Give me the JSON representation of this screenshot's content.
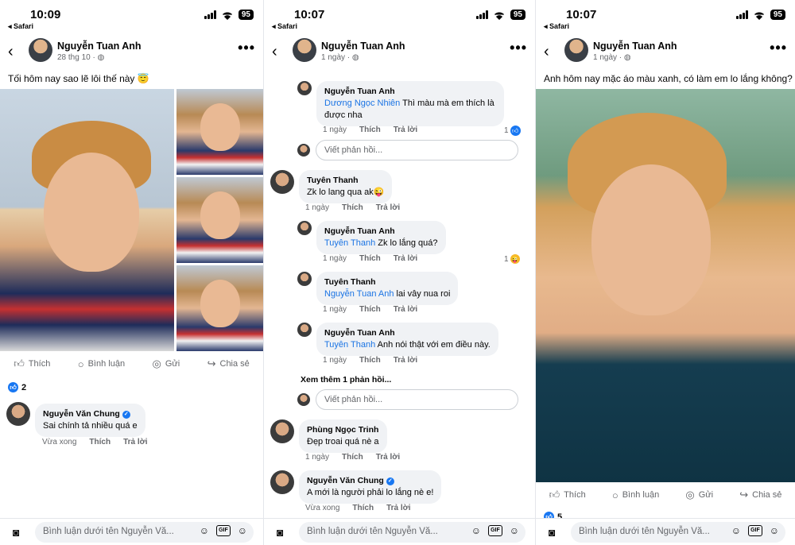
{
  "panels": [
    {
      "status": {
        "time": "10:09",
        "back_app": "Safari",
        "battery": "95"
      },
      "author": {
        "name": "Nguyễn Tuan Anh",
        "time": "28 thg 10"
      },
      "caption": "Tối hôm nay sao lẽ lôi thế này 😇",
      "actions": {
        "like": "Thích",
        "comment": "Bình luận",
        "send": "Gửi",
        "share": "Chia sẻ"
      },
      "reaction_count": "2",
      "comments": [
        {
          "author": "Nguyễn Văn Chung",
          "text": "Sai chính tả nhiều quá e",
          "time": "Vừa xong",
          "like": "Thích",
          "reply": "Trả lời"
        }
      ],
      "composer": {
        "placeholder": "Bình luận dưới tên Nguyễn Vă..."
      }
    },
    {
      "status": {
        "time": "10:07",
        "back_app": "Safari",
        "battery": "95"
      },
      "author": {
        "name": "Nguyễn Tuan Anh",
        "time": "1 ngày"
      },
      "comments": [
        {
          "author": "Nguyễn Tuan Anh",
          "mention": "Dương Ngọc Nhiên",
          "text": "Thì màu mà em thích là được nha",
          "time": "1 ngày",
          "like": "Thích",
          "reply": "Trả lời",
          "count": "1"
        },
        {
          "author": "Tuyên Thanh",
          "text": "Zk lo lang qua ak😜",
          "time": "1 ngày",
          "like": "Thích",
          "reply": "Trả lời"
        },
        {
          "author": "Nguyễn Tuan Anh",
          "mention": "Tuyên Thanh",
          "text": "Zk lo lắng quá?",
          "time": "1 ngày",
          "like": "Thích",
          "reply": "Trả lời",
          "count": "1"
        },
        {
          "author": "Tuyên Thanh",
          "mention": "Nguyễn Tuan Anh",
          "text": "lai vây nua roi",
          "time": "1 ngày",
          "like": "Thích",
          "reply": "Trả lời"
        },
        {
          "author": "Nguyễn Tuan Anh",
          "mention": "Tuyên Thanh",
          "text": "Anh nói thật với em điều này.",
          "time": "1 ngày",
          "like": "Thích",
          "reply": "Trả lời"
        },
        {
          "author": "Phùng Ngọc Trinh",
          "text": "Đẹp troai quá nè a",
          "time": "1 ngày",
          "like": "Thích",
          "reply": "Trả lời"
        },
        {
          "author": "Nguyễn Văn Chung",
          "text": "A mới là người phải lo lắng nè e!",
          "time": "Vừa xong",
          "like": "Thích",
          "reply": "Trả lời"
        }
      ],
      "reply_placeholder": "Viết phản hồi...",
      "more_replies": "Xem thêm 1 phản hồi...",
      "composer": {
        "placeholder": "Bình luận dưới tên Nguyễn Vă..."
      }
    },
    {
      "status": {
        "time": "10:07",
        "back_app": "Safari",
        "battery": "95"
      },
      "author": {
        "name": "Nguyễn Tuan Anh",
        "time": "1 ngày"
      },
      "caption": "Anh hôm nay mặc áo màu xanh, có làm em lo lắng không?",
      "actions": {
        "like": "Thích",
        "comment": "Bình luận",
        "send": "Gửi",
        "share": "Chia sẻ"
      },
      "reaction_count": "5",
      "composer": {
        "placeholder": "Bình luận dưới tên Nguyễn Vă..."
      }
    }
  ],
  "colors": {
    "accent": "#1877f2",
    "mention": "#1b74e4",
    "bubble": "#f0f2f5",
    "muted": "#65676b"
  },
  "icons": [
    "back-arrow-icon",
    "more-icon",
    "globe-icon",
    "like-icon",
    "comment-icon",
    "send-icon",
    "share-icon",
    "camera-icon",
    "sticker-icon",
    "gif-icon",
    "emoji-icon",
    "verified-icon"
  ]
}
